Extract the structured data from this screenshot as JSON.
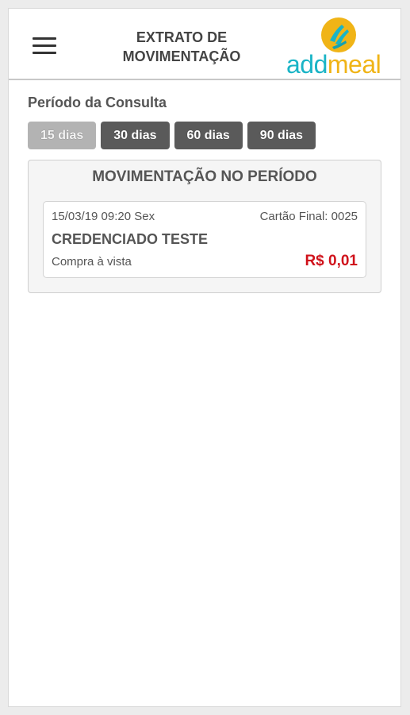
{
  "header": {
    "title_line1": "EXTRATO DE",
    "title_line2": "MOVIMENTAÇÃO",
    "logo": {
      "part1": "add",
      "part2": "meal"
    }
  },
  "period": {
    "label": "Período da Consulta",
    "options": [
      {
        "label": "15 dias",
        "active": true
      },
      {
        "label": "30 dias",
        "active": false
      },
      {
        "label": "60 dias",
        "active": false
      },
      {
        "label": "90 dias",
        "active": false
      }
    ]
  },
  "panel": {
    "title": "MOVIMENTAÇÃO NO PERÍODO",
    "transactions": [
      {
        "datetime": "15/03/19 09:20 Sex",
        "card_final": "Cartão Final: 0025",
        "merchant": "CREDENCIADO TESTE",
        "type": "Compra à vista",
        "amount": "R$ 0,01"
      }
    ]
  },
  "colors": {
    "amount": "#d0121b",
    "logo_add": "#1ab4c6",
    "logo_meal": "#f0b417",
    "button_inactive": "#5a5a5a",
    "button_active": "#b3b3b3"
  },
  "icons": {
    "menu": "hamburger-icon",
    "logo_emblem": "hands-emblem-icon"
  }
}
